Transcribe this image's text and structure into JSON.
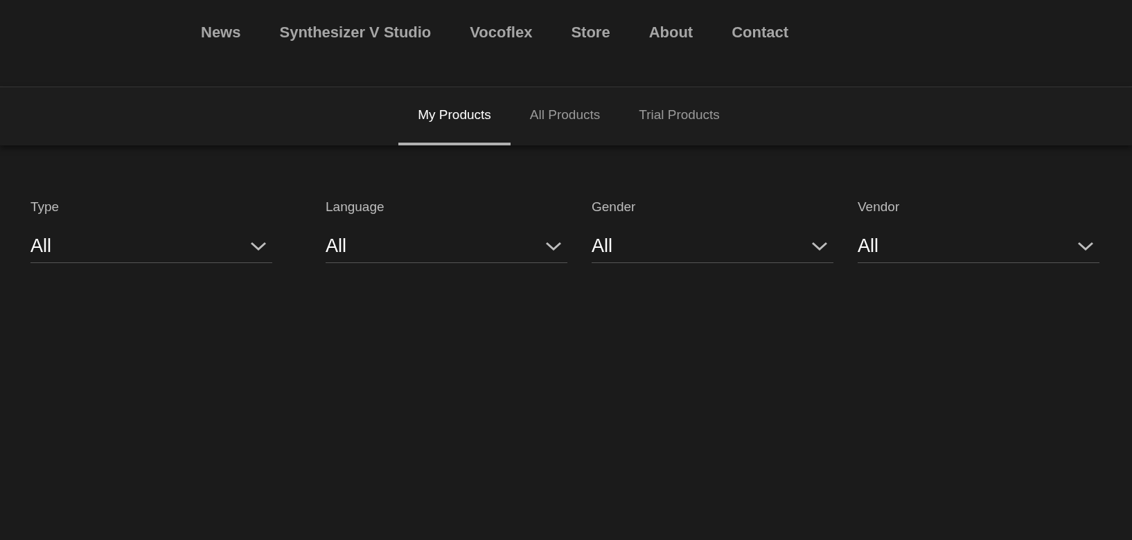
{
  "nav": {
    "items": [
      "News",
      "Synthesizer V Studio",
      "Vocoflex",
      "Store",
      "About",
      "Contact"
    ]
  },
  "tabs": [
    {
      "label": "My Products",
      "selected": true
    },
    {
      "label": "All Products",
      "selected": false
    },
    {
      "label": "Trial Products",
      "selected": false
    }
  ],
  "filters": [
    {
      "label": "Type",
      "value": "All"
    },
    {
      "label": "Language",
      "value": "All"
    },
    {
      "label": "Gender",
      "value": "All"
    },
    {
      "label": "Vendor",
      "value": "All"
    }
  ]
}
